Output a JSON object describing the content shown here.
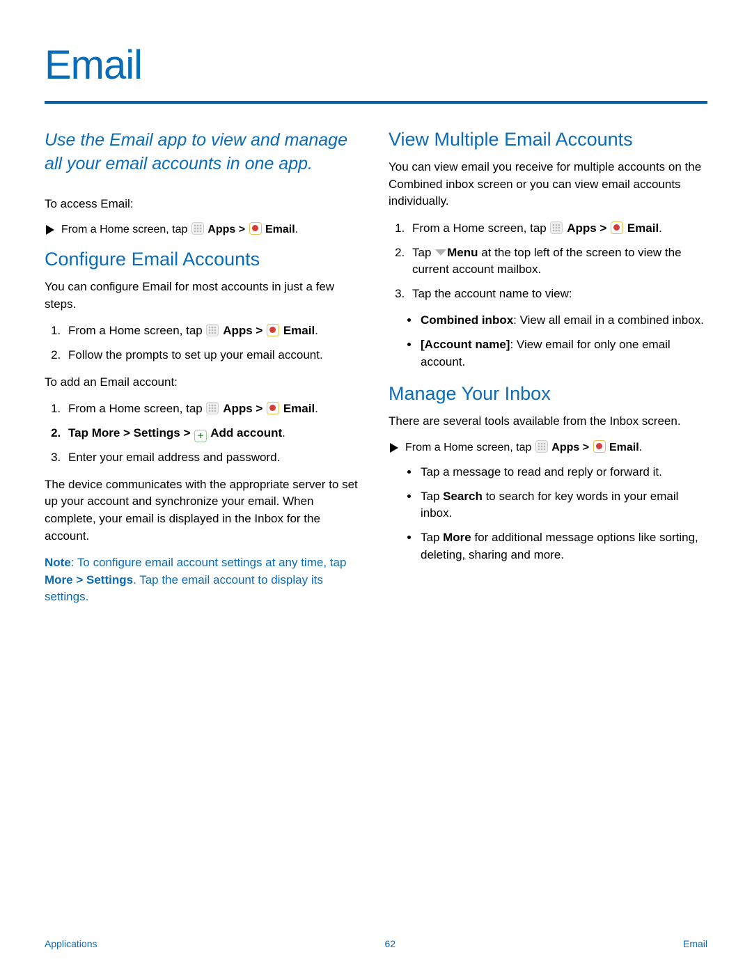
{
  "title": "Email",
  "intro": "Use the Email app to view and manage all your email accounts in one app.",
  "left": {
    "access_label": "To access Email:",
    "from_home": "From a Home screen, tap ",
    "apps_b": "Apps",
    "gt": " > ",
    "email_b": "Email",
    "period": ".",
    "configure_head": "Configure Email Accounts",
    "configure_intro": "You can configure Email for most accounts in just a few steps.",
    "step2_follow": "Follow the prompts to set up your email account.",
    "add_account_label": "To add an Email account:",
    "tap_pre": "Tap ",
    "more_settings": "More > Settings > ",
    "add_account_b": "Add account",
    "step3_enter": "Enter your email address and password.",
    "device_para": "The device communicates with the appropriate server to set up your account and synchronize your email. When complete, your email is displayed in the Inbox for the account.",
    "note_b": "Note",
    "note_1": ": To configure email account settings at any time, tap ",
    "note_more": "More > Settings",
    "note_2": ". Tap the email account to display its settings."
  },
  "right": {
    "view_head": "View Multiple Email Accounts",
    "view_intro": "You can view email you receive for multiple accounts on the Combined inbox screen or you can view email accounts individually.",
    "from_home": "From a Home screen, tap ",
    "apps_b": "Apps",
    "gt": " > ",
    "email_b": "Email",
    "period": ".",
    "tap_word": "Tap ",
    "menu_b": "Menu",
    "menu_rest": " at the top left of the screen to view the current account mailbox.",
    "step3_tap": "Tap the account name to view:",
    "combined_b": "Combined inbox",
    "combined_rest": ": View all email in a combined inbox.",
    "acct_b": "[Account name]",
    "acct_rest": ": View email for only one email account.",
    "manage_head": "Manage Your Inbox",
    "manage_intro": "There are several tools available from the Inbox screen.",
    "bullet_msg": "Tap a message to read and reply or forward it.",
    "bullet_search_pre": "Tap ",
    "bullet_search_b": "Search",
    "bullet_search_rest": " to search for key words in your email inbox.",
    "bullet_more_pre": "Tap ",
    "bullet_more_b": "More",
    "bullet_more_rest": " for additional message options like sorting, deleting, sharing and more."
  },
  "footer": {
    "left": "Applications",
    "page": "62",
    "right": "Email"
  }
}
